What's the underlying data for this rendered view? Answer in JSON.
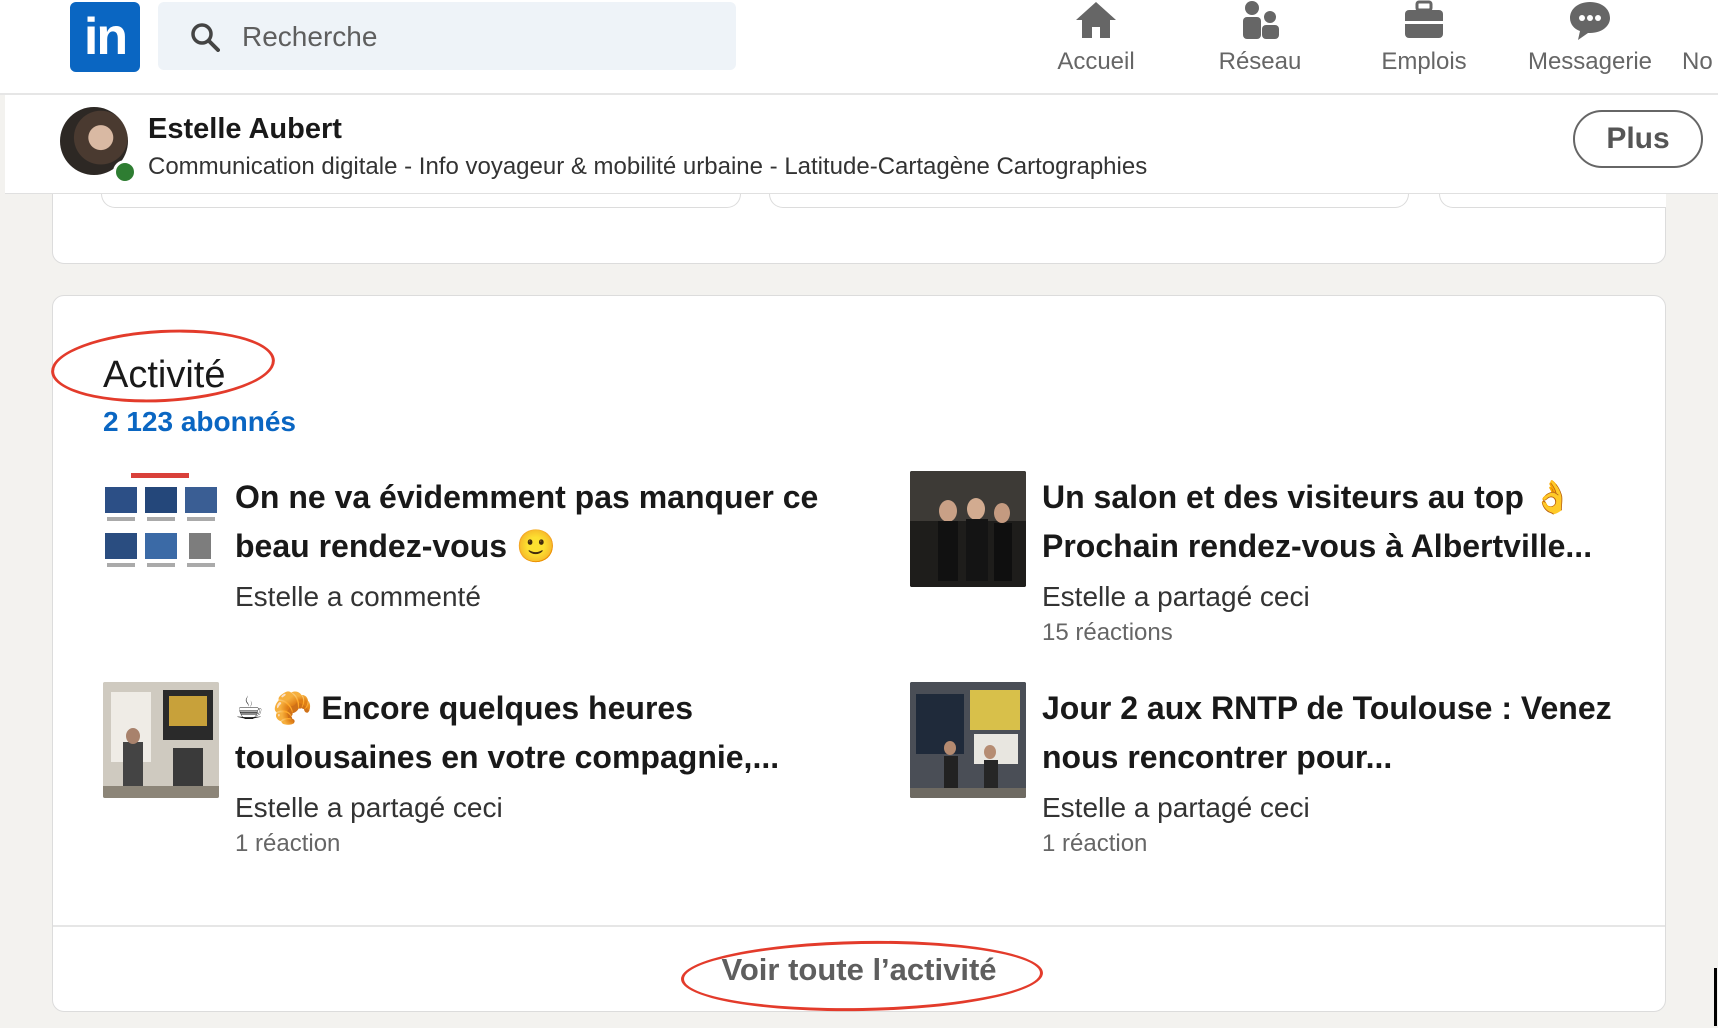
{
  "nav": {
    "logo_text": "in",
    "search_placeholder": "Recherche",
    "items": [
      {
        "label": "Accueil",
        "icon": "home-icon"
      },
      {
        "label": "Réseau",
        "icon": "network-icon"
      },
      {
        "label": "Emplois",
        "icon": "briefcase-icon"
      },
      {
        "label": "Messagerie",
        "icon": "message-icon"
      },
      {
        "label": "No",
        "icon": "notification-icon"
      }
    ]
  },
  "profile": {
    "name": "Estelle Aubert",
    "headline": "Communication digitale - Info voyageur & mobilité urbaine - Latitude-Cartagène Cartographies",
    "more_button": "Plus",
    "status": "online"
  },
  "activity": {
    "title": "Activité",
    "followers": "2 123 abonnés",
    "posts": [
      {
        "title": "On ne va évidemment pas manquer ce beau rendez-vous 🙂",
        "meta": "Estelle a commenté",
        "reactions": ""
      },
      {
        "title": "Un salon et des visiteurs au top 👌 Prochain rendez-vous à Albertville...",
        "meta": "Estelle a partagé ceci",
        "reactions": "15 réactions"
      },
      {
        "title": "☕ 🥐 Encore quelques heures toulousaines en votre compagnie,...",
        "meta": "Estelle a partagé ceci",
        "reactions": "1 réaction"
      },
      {
        "title": "Jour 2 aux RNTP de Toulouse : Venez nous rencontrer pour...",
        "meta": "Estelle a partagé ceci",
        "reactions": "1 réaction"
      }
    ],
    "see_all": "Voir toute l’activité"
  },
  "colors": {
    "brand": "#0a66c2",
    "annotation": "#e33b2b",
    "background": "#f3f2ef"
  }
}
